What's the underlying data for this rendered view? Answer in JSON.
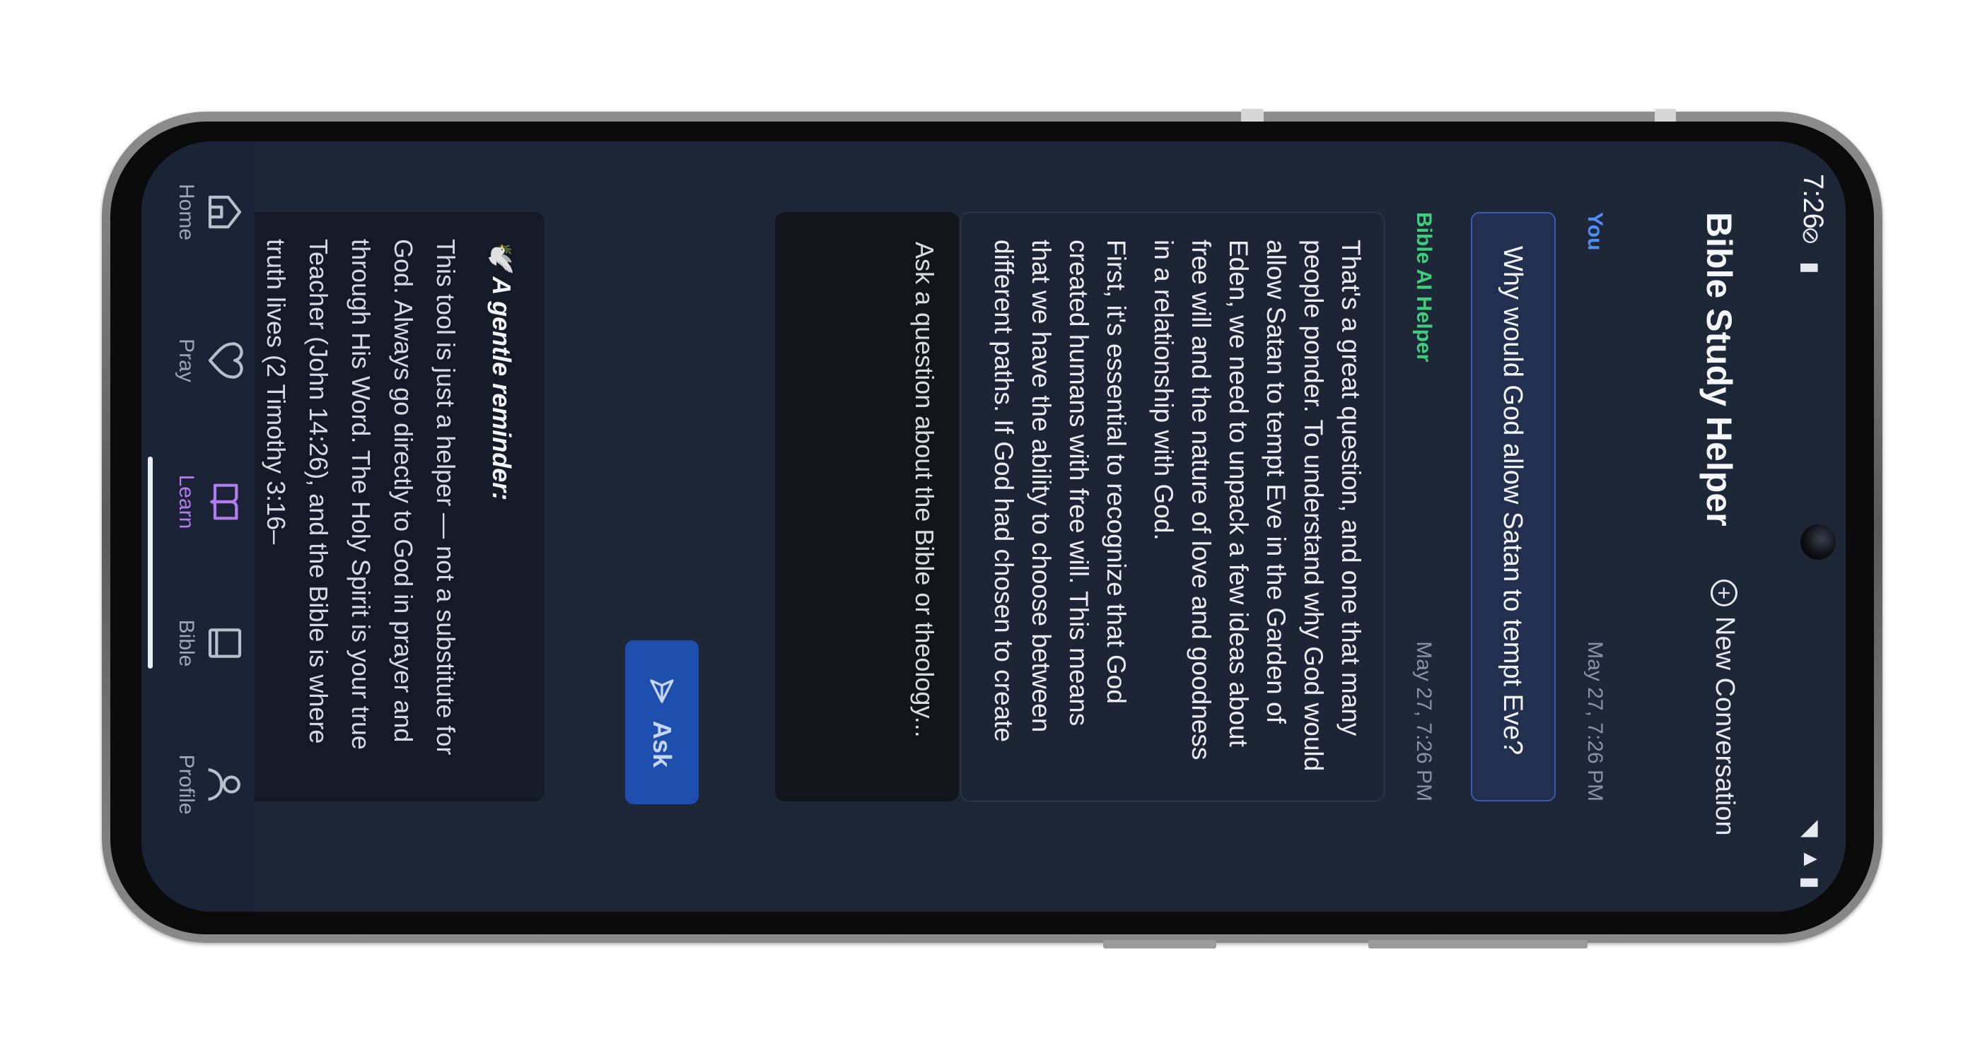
{
  "status_bar": {
    "time": "7:26"
  },
  "header": {
    "title": "Bible Study Helper",
    "new_conversation_label": "New Conversation"
  },
  "conversation": [
    {
      "role_label": "You",
      "timestamp": "May 27, 7:26 PM",
      "text": "Why would God allow Satan to tempt Eve?"
    },
    {
      "role_label": "Bible AI Helper",
      "timestamp": "May 27, 7:26 PM",
      "paragraphs": [
        "That's a great question, and one that many people ponder. To understand why God would allow Satan to tempt Eve in the Garden of Eden, we need to unpack a few ideas about free will and the nature of love and goodness in a relationship with God.",
        "First, it's essential to recognize that God created humans with free will. This means that we have the ability to choose between different paths. If God had chosen to create"
      ]
    }
  ],
  "input": {
    "placeholder": "Ask a question about the Bible or theology...",
    "value": "",
    "ask_label": "Ask"
  },
  "reminder": {
    "emoji": "🕊️",
    "heading": "A gentle reminder:",
    "text": "This tool is just a helper — not a substitute for God. Always go directly to God in prayer and through His Word. The Holy Spirit is your true Teacher (John 14:26), and the Bible is where truth lives (2 Timothy 3:16–"
  },
  "nav": {
    "items": [
      {
        "label": "Home",
        "icon": "home-icon"
      },
      {
        "label": "Pray",
        "icon": "heart-icon"
      },
      {
        "label": "Learn",
        "icon": "book-open-icon",
        "active": true
      },
      {
        "label": "Bible",
        "icon": "book-icon"
      },
      {
        "label": "Profile",
        "icon": "person-icon"
      }
    ]
  },
  "colors": {
    "background": "#1e2738",
    "user_label": "#4f8ff7",
    "ai_label": "#3fcf7a",
    "accent_active": "#b57cf2",
    "ask_button": "#1f4fae"
  }
}
